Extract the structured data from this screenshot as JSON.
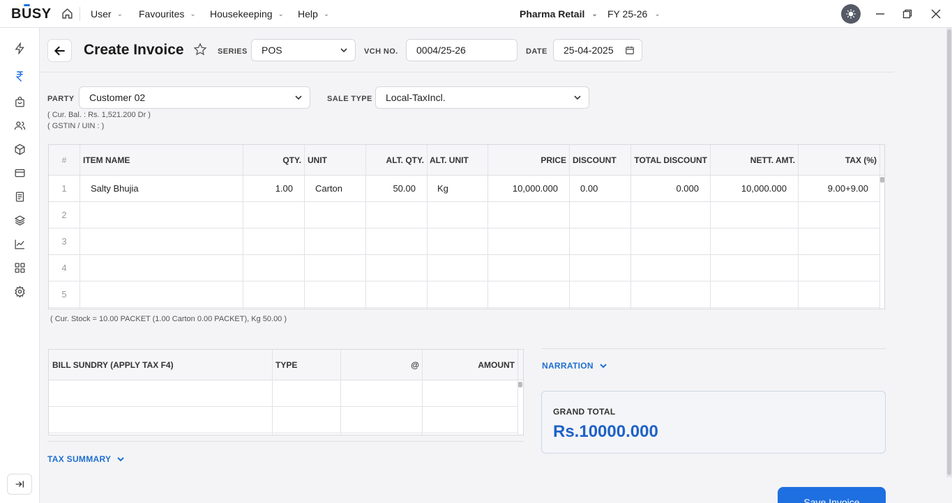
{
  "app": {
    "brand": "BUSY",
    "company": "Pharma Retail",
    "fy": "FY 25-26"
  },
  "menu": [
    "User",
    "Favourites",
    "Housekeeping",
    "Help"
  ],
  "page": {
    "title": "Create Invoice",
    "series_label": "SERIES",
    "series_value": "POS",
    "vch_label": "VCH NO.",
    "vch_value": "0004/25-26",
    "date_label": "DATE",
    "date_value": "25-04-2025"
  },
  "party": {
    "label": "PARTY",
    "value": "Customer 02",
    "balance": "( Cur. Bal. : Rs. 1,521.200 Dr )",
    "gstin": "( GSTIN / UIN :  )",
    "sale_type_label": "SALE TYPE",
    "sale_type_value": "Local-TaxIncl."
  },
  "items": {
    "columns": [
      "#",
      "ITEM NAME",
      "QTY.",
      "UNIT",
      "ALT. QTY.",
      "ALT. UNIT",
      "PRICE",
      "DISCOUNT",
      "TOTAL DISCOUNT",
      "NETT. AMT.",
      "TAX (%)"
    ],
    "rows": [
      {
        "num": "1",
        "item": "Salty Bhujia",
        "qty": "1.00",
        "unit": "Carton",
        "alt_qty": "50.00",
        "alt_unit": "Kg",
        "price": "10,000.000",
        "discount": "0.00",
        "total_discount": "0.000",
        "nett_amt": "10,000.000",
        "tax": "9.00+9.00"
      },
      {
        "num": "2"
      },
      {
        "num": "3"
      },
      {
        "num": "4"
      },
      {
        "num": "5"
      }
    ],
    "stock_info": "( Cur. Stock = 10.00  PACKET (1.00 Carton 0.00 PACKET),  Kg 50.00 )"
  },
  "bill_sundry": {
    "columns": [
      "BILL SUNDRY (APPLY TAX F4)",
      "TYPE",
      "@",
      "AMOUNT"
    ]
  },
  "narration_label": "NARRATION",
  "tax_summary_label": "TAX SUMMARY",
  "grand_total": {
    "label": "GRAND TOTAL",
    "value": "Rs.10000.000"
  },
  "save_button": "Save Invoice",
  "icons": {
    "sidebar": [
      "lightning-icon",
      "rupee-icon",
      "shopping-bag-icon",
      "users-icon",
      "box-icon",
      "card-icon",
      "document-icon",
      "layers-icon",
      "chart-icon",
      "grid-icon",
      "gear-icon"
    ]
  },
  "colors": {
    "accent": "#1e6fe0",
    "grand_total": "#1e62c8"
  }
}
